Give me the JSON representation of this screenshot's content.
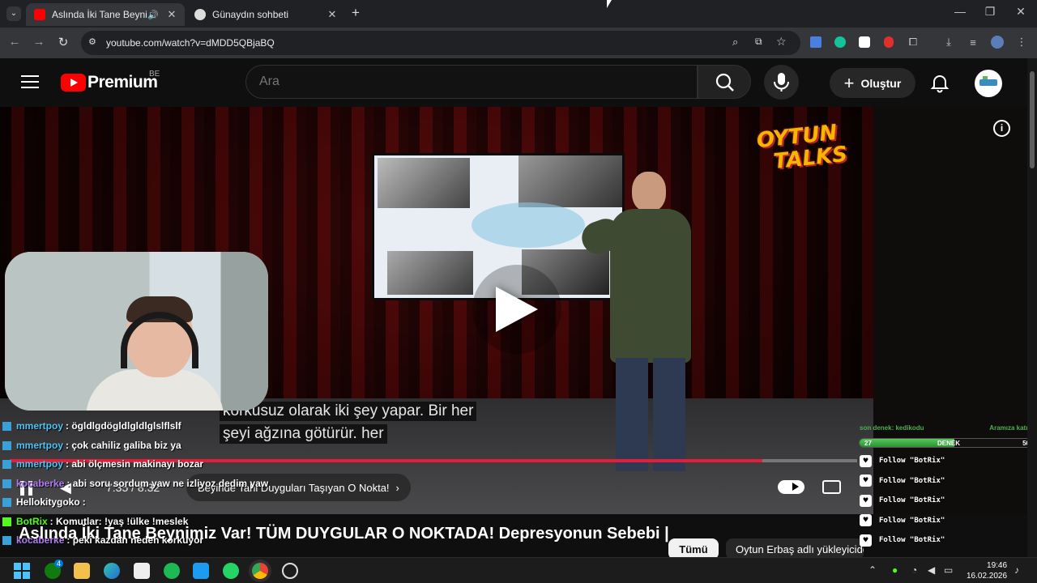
{
  "browser": {
    "tabs": [
      {
        "title": "Aslında İki Tane Beynimiz Var! TÜM DUYGULAR O NOKTADA!",
        "active": true
      },
      {
        "title": "Günaydın sohbeti",
        "active": false
      }
    ],
    "new_tab": "+",
    "url": "youtube.com/watch?v=dMDD5QBjaBQ"
  },
  "youtube": {
    "brand": "Premium",
    "region": "BE",
    "search_placeholder": "Ara",
    "create_label": "Oluştur"
  },
  "video": {
    "channel_logo_line1": "OYTUN",
    "channel_logo_line2": "TALKS",
    "captions": [
      "korkusuz olarak iki şey yapar. Bir her",
      "şeyi ağzına götürür. her"
    ],
    "time": "7:35 / 8:32",
    "progress": 0.888,
    "chapter": "Beyinde Tahl Duyguları Taşıyan O Nokta!",
    "title": "Aslında İki Tane Beynimiz Var! TÜM DUYGULAR O NOKTADA! Depresyonun Sebebi |",
    "filter_all": "Tümü",
    "filter_uploads": "Oytun Erbaş adlı yükleyiciden"
  },
  "chat": [
    {
      "user": "mmertpoy",
      "message": ": ögldlgdögldlgldlglslflslf",
      "color": "#4fc3f7"
    },
    {
      "user": "mmertpoy",
      "message": ": çok cahiliz galiba biz ya",
      "color": "#4fc3f7"
    },
    {
      "user": "mmertpoy",
      "message": ": abi ölçmesin makinayı bozar",
      "color": "#4fc3f7"
    },
    {
      "user": "kocaberke",
      "message": ": abi soru sordum yaw ne izliyoz dedim yaw",
      "color": "#b07cf5"
    },
    {
      "user": "Hellokitygoko",
      "message": " :",
      "color": "#ffffff"
    },
    {
      "user": "BotRix",
      "message": ": Komutlar: !yaş !ülke !meslek",
      "color": "#53fc18"
    },
    {
      "user": "kocaberke",
      "message": ": peki kazdan neden korkuyor",
      "color": "#b07cf5"
    }
  ],
  "widget": {
    "top_left": "son denek: kedikodu",
    "top_right": "Aramıza katılan",
    "bar_min": "27",
    "bar_label": "DENEK",
    "bar_max": "50",
    "bar_fraction": 0.54,
    "rows": [
      "Follow \"BotRix\"",
      "Follow \"BotRix\"",
      "Follow \"BotRix\"",
      "Follow \"BotRix\"",
      "Follow \"BotRix\""
    ]
  },
  "taskbar": {
    "time": "19:46",
    "date": "16.02.2026",
    "badge": "4"
  },
  "colors": {
    "youtube_red": "#ff0000",
    "progress": "#e51d3a",
    "widget_green": "#4caf50"
  }
}
